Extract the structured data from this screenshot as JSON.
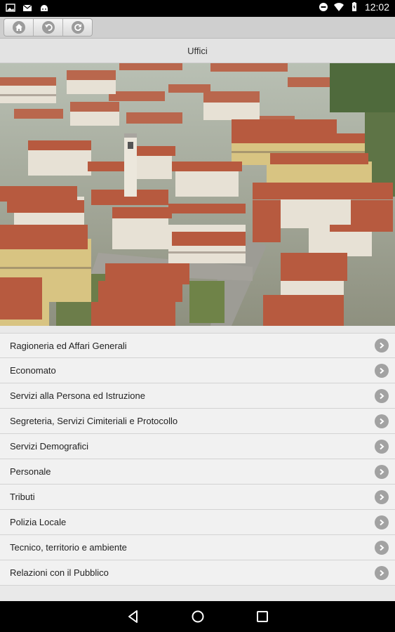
{
  "status_bar": {
    "time": "12:02",
    "left_icons": [
      "image-icon",
      "mail-icon",
      "android-icon"
    ],
    "right_icons": [
      "do-not-disturb-icon",
      "wifi-icon",
      "battery-icon"
    ]
  },
  "toolbar": {
    "buttons": [
      "home-icon",
      "back-icon",
      "refresh-icon"
    ]
  },
  "header": {
    "title": "Uffici"
  },
  "menu": {
    "items": [
      {
        "label": "Ragioneria ed Affari Generali"
      },
      {
        "label": "Economato"
      },
      {
        "label": "Servizi alla Persona ed Istruzione"
      },
      {
        "label": "Segreteria, Servizi Cimiteriali e Protocollo"
      },
      {
        "label": "Servizi Demografici"
      },
      {
        "label": "Personale"
      },
      {
        "label": "Tributi"
      },
      {
        "label": "Polizia Locale"
      },
      {
        "label": "Tecnico, territorio e ambiente"
      },
      {
        "label": "Relazioni con il Pubblico"
      }
    ]
  },
  "nav_bar": {
    "buttons": [
      "back-triangle-icon",
      "home-circle-icon",
      "recents-square-icon"
    ]
  }
}
